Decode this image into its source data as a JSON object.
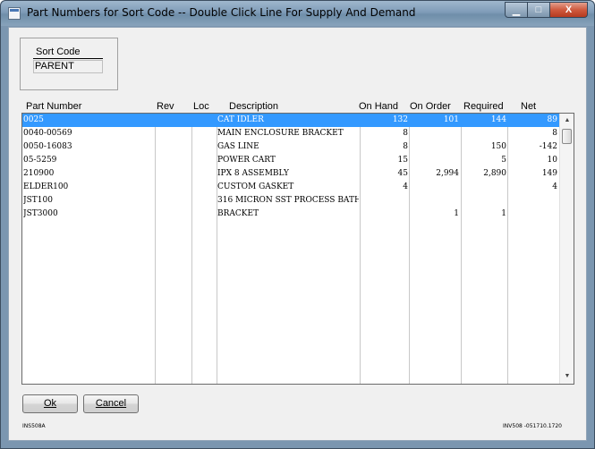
{
  "window": {
    "title": "Part Numbers for Sort Code -- Double Click Line For Supply And Demand",
    "controls": {
      "minimize": "▁",
      "maximize": "□",
      "close": "X"
    }
  },
  "sort": {
    "label": "Sort Code",
    "value": "PARENT"
  },
  "table": {
    "columns": [
      "Part Number",
      "Rev",
      "Loc",
      "Description",
      "On Hand",
      "On Order",
      "Required",
      "Net"
    ],
    "selected_index": 0,
    "rows": [
      {
        "part": "0025",
        "rev": "",
        "loc": "",
        "desc": "CAT IDLER",
        "onhand": "132",
        "onorder": "101",
        "required": "144",
        "net": "89"
      },
      {
        "part": "0040-00569",
        "rev": "",
        "loc": "",
        "desc": "MAIN ENCLOSURE BRACKET",
        "onhand": "8",
        "onorder": "",
        "required": "",
        "net": "8"
      },
      {
        "part": "0050-16083",
        "rev": "",
        "loc": "",
        "desc": "GAS LINE",
        "onhand": "8",
        "onorder": "",
        "required": "150",
        "net": "-142"
      },
      {
        "part": "05-5259",
        "rev": "",
        "loc": "",
        "desc": "POWER CART",
        "onhand": "15",
        "onorder": "",
        "required": "5",
        "net": "10"
      },
      {
        "part": "210900",
        "rev": "",
        "loc": "",
        "desc": "IPX 8 ASSEMBLY",
        "onhand": "45",
        "onorder": "2,994",
        "required": "2,890",
        "net": "149"
      },
      {
        "part": "ELDER100",
        "rev": "",
        "loc": "",
        "desc": "CUSTOM GASKET",
        "onhand": "4",
        "onorder": "",
        "required": "",
        "net": "4"
      },
      {
        "part": "JST100",
        "rev": "",
        "loc": "",
        "desc": "316 MICRON SST PROCESS BATH",
        "onhand": "",
        "onorder": "",
        "required": "",
        "net": ""
      },
      {
        "part": "JST3000",
        "rev": "",
        "loc": "",
        "desc": "BRACKET",
        "onhand": "",
        "onorder": "1",
        "required": "1",
        "net": ""
      }
    ]
  },
  "scrollbar": {
    "up": "▲",
    "down": "▼"
  },
  "buttons": {
    "ok": "Ok",
    "cancel": "Cancel"
  },
  "footer": {
    "left": "INS508A",
    "right": "INV508 -051710.1720"
  },
  "colors": {
    "selection": "#3399ff",
    "titlebar": "#7f9cb8",
    "close": "#c44a2f"
  }
}
